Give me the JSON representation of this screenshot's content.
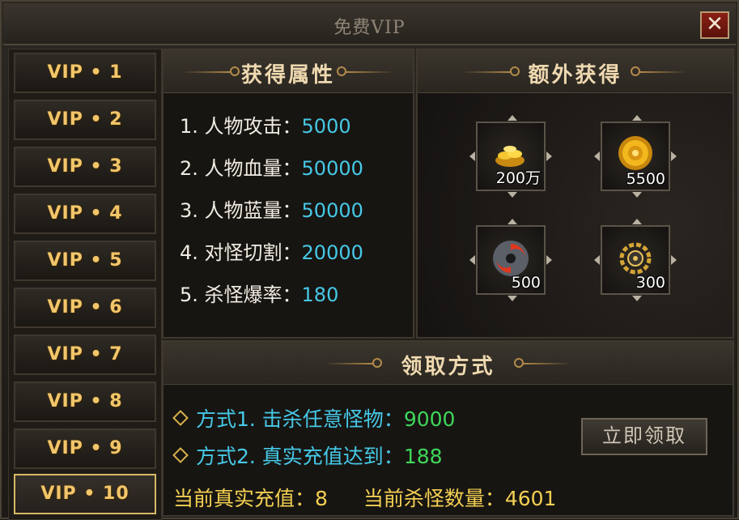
{
  "window": {
    "title": "免费VIP",
    "close_icon": "close-icon"
  },
  "sidebar": {
    "tabs": [
      "VIP • 1",
      "VIP • 2",
      "VIP • 3",
      "VIP • 4",
      "VIP • 5",
      "VIP • 6",
      "VIP • 7",
      "VIP • 8",
      "VIP • 9",
      "VIP • 10"
    ],
    "selected": "VIP • 10"
  },
  "attributes": {
    "title": "获得属性",
    "rows": [
      {
        "label": "1. 人物攻击：",
        "value": "5000"
      },
      {
        "label": "2. 人物血量：",
        "value": "50000"
      },
      {
        "label": "3. 人物蓝量：",
        "value": "50000"
      },
      {
        "label": "4. 对怪切割：",
        "value": "20000"
      },
      {
        "label": "5. 杀怪爆率：",
        "value": "180"
      }
    ]
  },
  "extra": {
    "title": "额外获得",
    "items": [
      {
        "icon": "gold-ingots-icon",
        "count": "200万"
      },
      {
        "icon": "gold-coin-icon",
        "count": "5500"
      },
      {
        "icon": "swirl-orb-icon",
        "count": "500"
      },
      {
        "icon": "golden-emblem-icon",
        "count": "300"
      }
    ]
  },
  "claim": {
    "title": "领取方式",
    "method1_label": "方式1. 击杀任意怪物：",
    "method1_value": "9000",
    "method2_label": "方式2. 真实充值达到：",
    "method2_value": "188",
    "button": "立即领取",
    "current_recharge_label": "当前真实充值：",
    "current_recharge_value": "8",
    "current_kills_label": "当前杀怪数量：",
    "current_kills_value": "4601"
  },
  "colors": {
    "accent_gold": "#f2c66a",
    "value_cyan": "#46c8e6",
    "value_green": "#3fd65a"
  }
}
